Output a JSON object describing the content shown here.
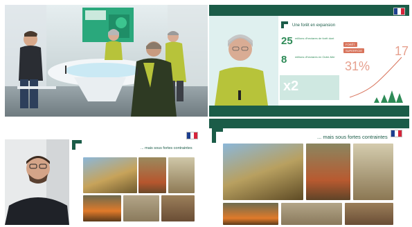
{
  "panels": {
    "studio": {
      "screen_text": "",
      "colors": {
        "studio_bg": "#cfd7d5",
        "screen": "#2aa87c",
        "desk": "#f3f6f8"
      }
    },
    "presenter": {
      "caption": "Une forêt en expansion",
      "stats": [
        {
          "value": "25",
          "text": "millions d'hectares de forêt dont"
        },
        {
          "value": "8",
          "text": "millions d'hectares en Outre-Mer"
        },
        {
          "value": "x2",
          "text": ""
        }
      ],
      "percent": "31%",
      "big_number": "17",
      "pills": [
        "FORÊT",
        "SUPERFICIE"
      ],
      "colors": {
        "accent": "#2e8b57",
        "pill": "#d8745c",
        "bar": "#1b5c48"
      }
    },
    "webcam_slide": {
      "slide_title": "... mais sous fortes contraintes"
    },
    "slide_full": {
      "slide_title": "... mais sous fortes contraintes"
    }
  },
  "icons": [
    "france-flag-icon",
    "green-arrow-logo-icon"
  ]
}
